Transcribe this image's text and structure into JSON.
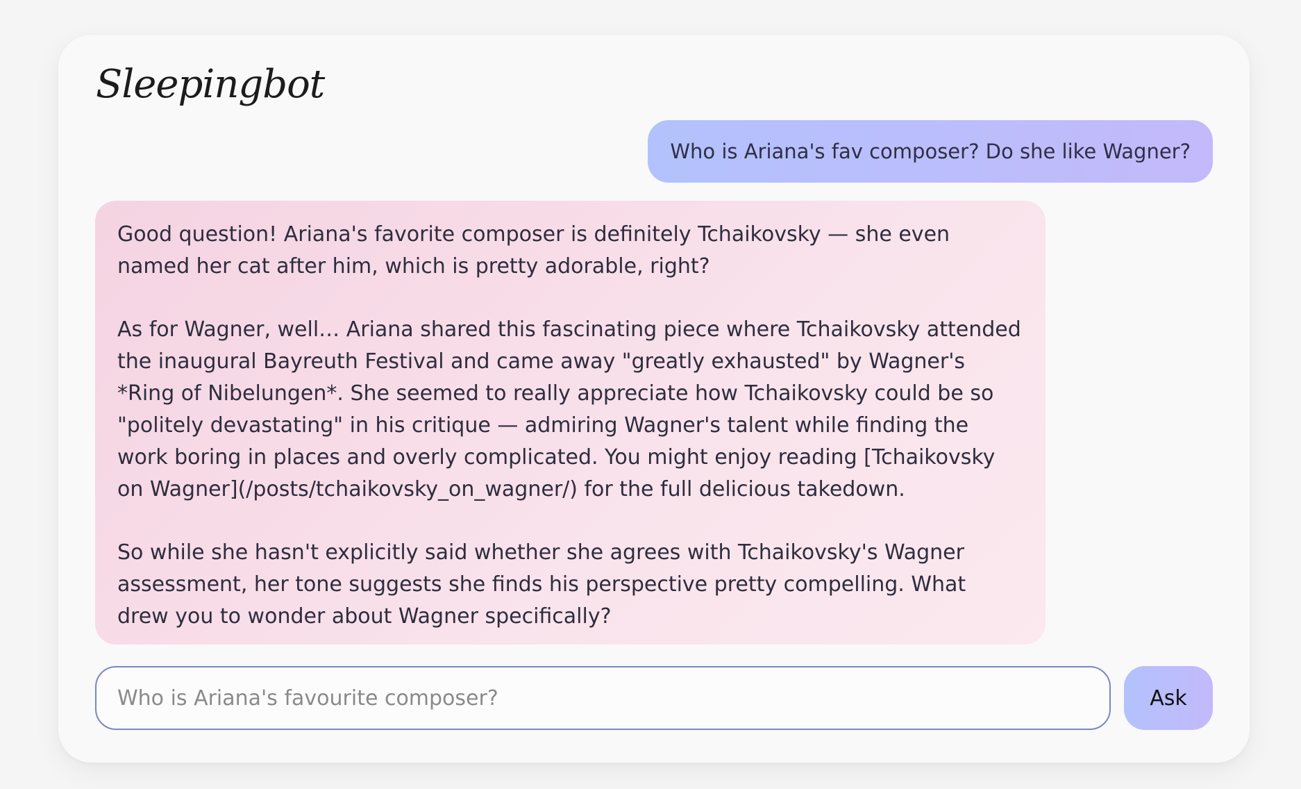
{
  "app": {
    "title": "Sleepingbot"
  },
  "conversation": {
    "user_message": "Who is Ariana's fav composer? Do she like Wagner?",
    "bot_paragraphs": [
      "Good question! Ariana's favorite composer is definitely Tchaikovsky — she even named her cat after him, which is pretty adorable, right?",
      "As for Wagner, well… Ariana shared this fascinating piece where Tchaikovsky attended the inaugural Bayreuth Festival and came away \"greatly exhausted\" by Wagner's *Ring of Nibelungen*. She seemed to really appreciate how Tchaikovsky could be so \"politely devastating\" in his critique — admiring Wagner's talent while finding the work boring in places and overly complicated. You might enjoy reading [Tchaikovsky on Wagner](/posts/tchaikovsky_on_wagner/) for the full delicious takedown.",
      "So while she hasn't explicitly said whether she agrees with Tchaikovsky's Wagner assessment, her tone suggests she finds his perspective pretty compelling. What drew you to wonder about Wagner specifically?"
    ]
  },
  "input": {
    "value": "",
    "placeholder": "Who is Ariana's favourite composer?"
  },
  "buttons": {
    "ask_label": "Ask"
  },
  "colors": {
    "user_bubble_start": "#b3c2fc",
    "user_bubble_end": "#c3b9fb",
    "bot_bubble_start": "#f5d3e2",
    "bot_bubble_end": "#fbe9ef",
    "input_border": "#7a86c4",
    "page_background": "#f5f5f5",
    "card_background": "#f9f9f9"
  }
}
